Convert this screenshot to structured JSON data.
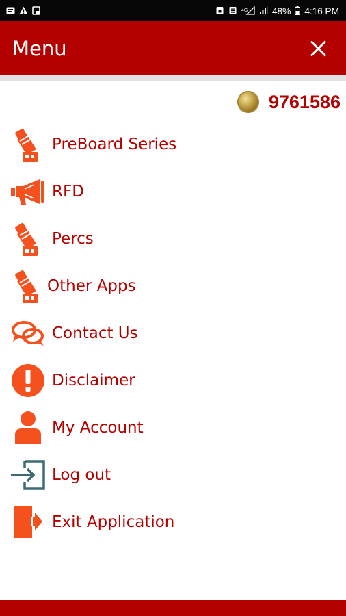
{
  "status_bar": {
    "battery": "48%",
    "time": "4:16 PM",
    "left_icons": [
      "message-icon",
      "warning-icon",
      "gallery-icon"
    ],
    "right_icons": [
      "lock-icon",
      "nfc-icon",
      "network-icon",
      "signal-icon",
      "battery-icon"
    ]
  },
  "header": {
    "title": "Menu",
    "background": "#b50000"
  },
  "account": {
    "coin_icon": "coin-icon",
    "coin_value": "9761586"
  },
  "menu": {
    "items": [
      {
        "label": "PreBoard Series",
        "icon": "bell-icon"
      },
      {
        "label": "RFD",
        "icon": "megaphone-icon"
      },
      {
        "label": "Percs",
        "icon": "bell-icon"
      },
      {
        "label": "Other Apps",
        "icon": "bell-icon"
      },
      {
        "label": "Contact Us",
        "icon": "chat-bubbles-icon"
      },
      {
        "label": "Disclaimer",
        "icon": "exclamation-icon"
      },
      {
        "label": "My Account",
        "icon": "user-icon"
      },
      {
        "label": "Log out",
        "icon": "logout-icon"
      },
      {
        "label": "Exit Application",
        "icon": "exit-icon"
      }
    ]
  },
  "colors": {
    "accent": "#b50000",
    "icon": "#f4511e"
  }
}
